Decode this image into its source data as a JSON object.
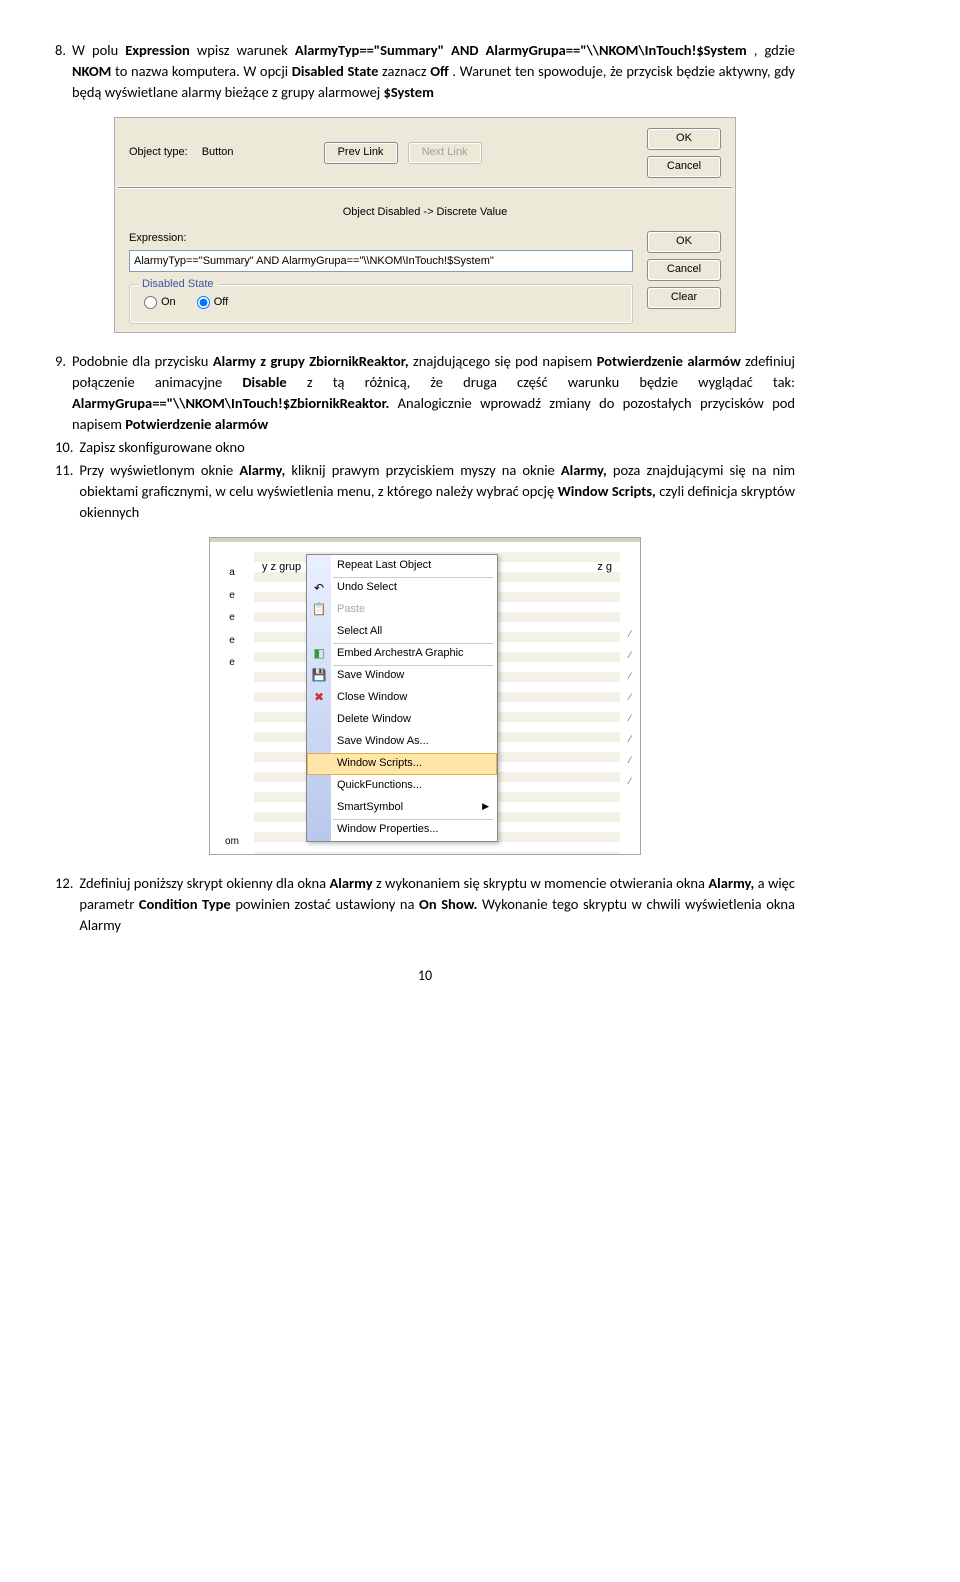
{
  "step8": {
    "num": "8.",
    "text_a": "W polu ",
    "text_b": " wpisz warunek ",
    "text_c": ", gdzie ",
    "text_d": " to nazwa komputera. W opcji ",
    "text_e": " zaznacz ",
    "text_f": ". Warunet ten spowoduje, że przycisk będzie aktywny, gdy będą wyświetlane alarmy bieżące z grupy alarmowej ",
    "expression": "Expression",
    "cond": "AlarmyTyp==\"Summary\" AND AlarmyGrupa==\"\\\\NKOM\\InTouch!$System",
    "nkom": "NKOM",
    "disabled_state": "Disabled State",
    "off": "Off",
    "system": "$System"
  },
  "dialog1": {
    "obj_type_label": "Object type:",
    "obj_type_value": "Button",
    "prev_link": "Prev Link",
    "next_link": "Next Link",
    "ok": "OK",
    "cancel": "Cancel"
  },
  "dialog2": {
    "title": "Object Disabled -> Discrete Value",
    "expr_label": "Expression:",
    "expr_value": "AlarmyTyp==\"Summary\" AND AlarmyGrupa==\"\\\\NKOM\\InTouch!$System\"",
    "group_title": "Disabled State",
    "on": "On",
    "off": "Off",
    "ok": "OK",
    "cancel": "Cancel",
    "clear": "Clear"
  },
  "step9": {
    "num": "9.",
    "t1": "Podobnie dla przycisku ",
    "b1": "Alarmy z grupy ZbiornikReaktor,",
    "t2": " znajdującego się pod napisem ",
    "b2": "Potwierdzenie alarmów",
    "t3": " zdefiniuj połączenie animacyjne ",
    "b3": "Disable",
    "t4": " z tą różnicą, że druga część warunku będzie wyglądać tak: ",
    "b4": "AlarmyGrupa==\"\\\\NKOM\\InTouch!$ZbiornikReaktor.",
    "t5": " Analogicznie wprowadź zmiany do pozostałych przycisków pod napisem ",
    "b5": "Potwierdzenie alarmów"
  },
  "step10": {
    "num": "10.",
    "text": "Zapisz skonfigurowane okno"
  },
  "step11": {
    "num": "11.",
    "t1": "Przy wyświetlonym oknie ",
    "b1": "Alarmy,",
    "t2": " kliknij prawym przyciskiem myszy na oknie ",
    "b2": "Alarmy,",
    "t3": " poza znajdującymi się na nim obiektami graficznymi, w celu wyświetlenia menu, z którego należy wybrać opcję ",
    "b3": "Window Scripts,",
    "t4": " czyli definicja skryptów okiennych"
  },
  "context": {
    "left_label": "y z grup",
    "right_label": "z g",
    "left_strip_a": "a",
    "left_strip_e": "e",
    "left_strip_om": "om",
    "menu": {
      "repeat": "Repeat Last Object",
      "undo": "Undo Select",
      "paste": "Paste",
      "select_all": "Select All",
      "embed": "Embed ArchestrA Graphic",
      "save": "Save Window",
      "close": "Close Window",
      "delete": "Delete Window",
      "saveas": "Save Window As...",
      "scripts": "Window Scripts...",
      "quick": "QuickFunctions...",
      "smart": "SmartSymbol",
      "props": "Window Properties..."
    }
  },
  "step12": {
    "num": "12.",
    "t1": "Zdefiniuj poniższy skrypt okienny dla okna ",
    "b1": "Alarmy",
    "t2": " z wykonaniem się skryptu w momencie otwierania okna ",
    "b2": "Alarmy,",
    "t3": " a więc parametr ",
    "b3": "Condition Type",
    "t4": " powinien zostać ustawiony na ",
    "b4": "On Show.",
    "t5": " Wykonanie tego skryptu w chwili wyświetlenia okna Alarmy"
  },
  "page_num": "10"
}
